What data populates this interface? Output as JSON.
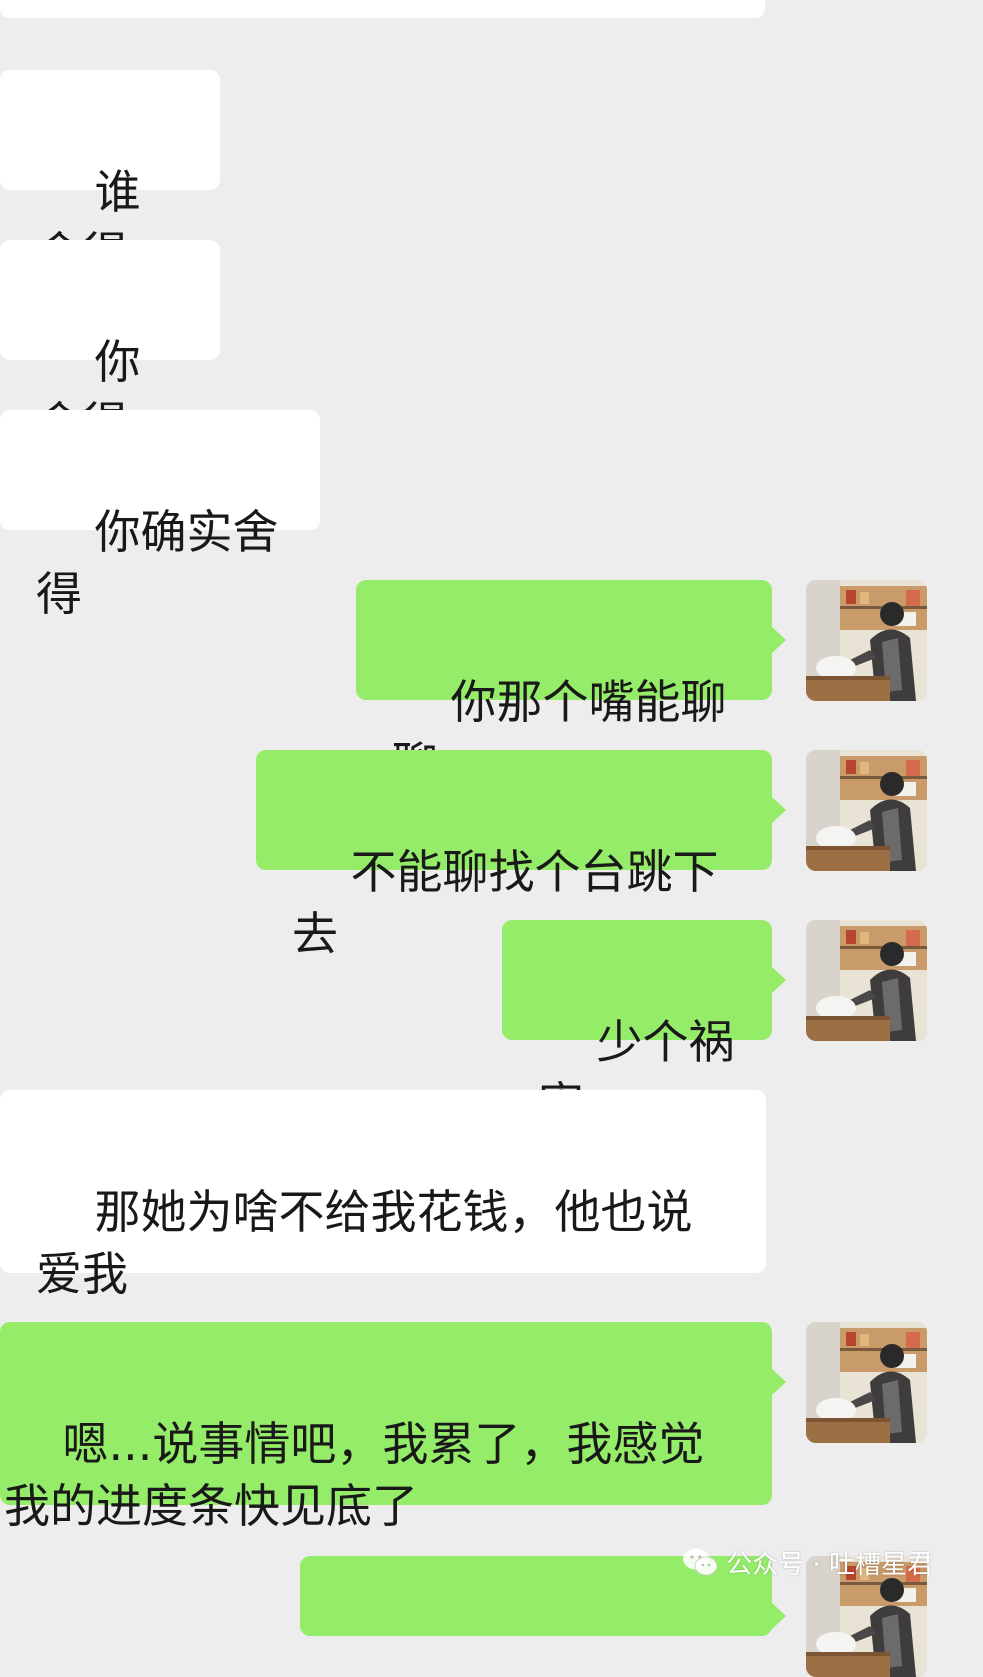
{
  "messages": [
    {
      "side": "in",
      "text": "谁舍得"
    },
    {
      "side": "in",
      "text": "你舍得"
    },
    {
      "side": "in",
      "text": "你确实舍得"
    },
    {
      "side": "out",
      "text": "你那个嘴能聊聊"
    },
    {
      "side": "out",
      "text": "不能聊找个台跳下去"
    },
    {
      "side": "out",
      "text": "少个祸害"
    },
    {
      "side": "in",
      "text": "那她为啥不给我花钱，他也说爱我"
    },
    {
      "side": "out",
      "text": "嗯...说事情吧，我累了，我感觉我的进度条快见底了"
    }
  ],
  "watermark": {
    "text": "公众号 · 吐槽星君",
    "icon": "wechat-icon"
  },
  "colors": {
    "background": "#ededed",
    "incoming_bubble": "#ffffff",
    "outgoing_bubble": "#95ec69",
    "text": "#191919"
  }
}
